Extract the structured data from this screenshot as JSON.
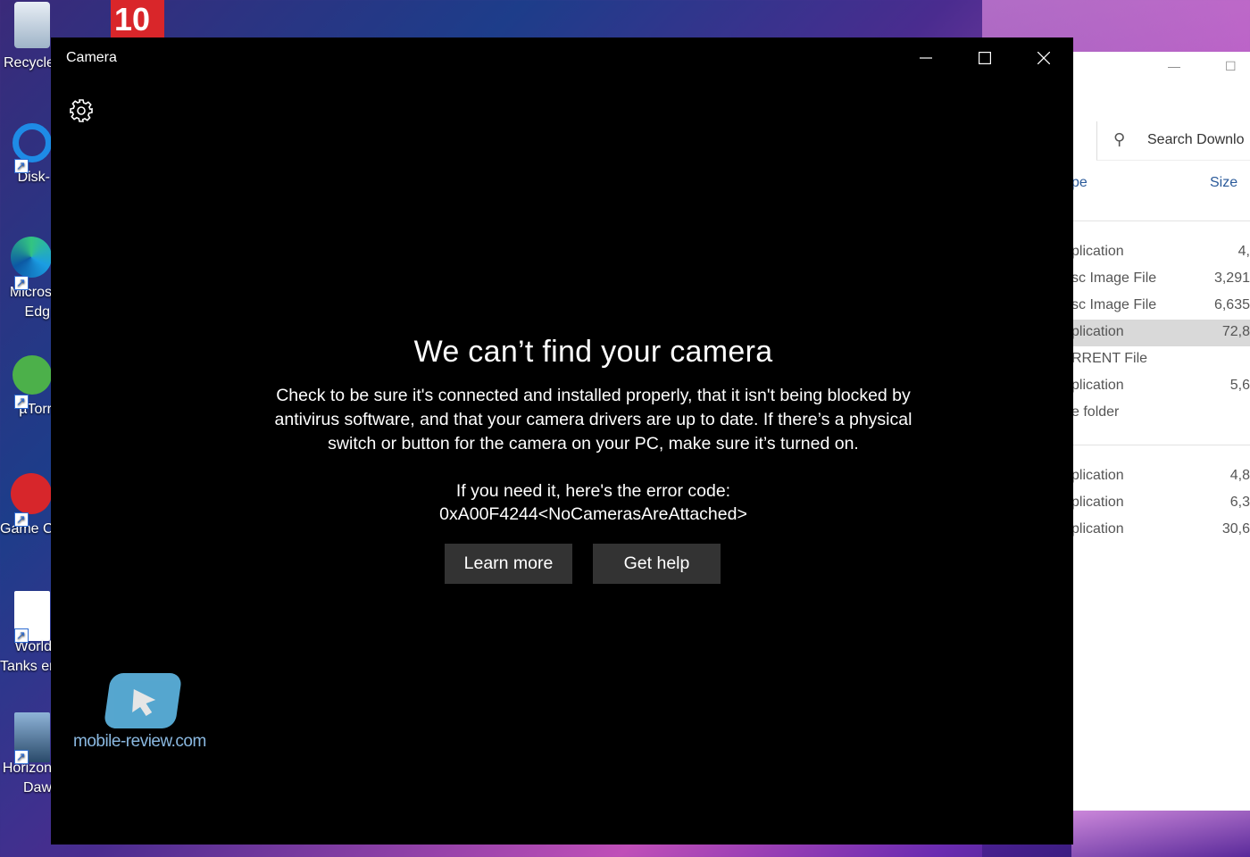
{
  "desktop": {
    "icons": [
      {
        "label": "Recycle"
      },
      {
        "label": "Disk-"
      },
      {
        "label": "Micros",
        "label2": "Edg"
      },
      {
        "label": "µTorr"
      },
      {
        "label": "Game C"
      },
      {
        "label": "World",
        "label2": "Tanks en"
      },
      {
        "label": "Horizon",
        "label2": "Daw"
      }
    ],
    "badge_text": "10"
  },
  "explorer": {
    "search_placeholder": "Search Downlo",
    "columns": [
      "pe",
      "Size"
    ],
    "rows_top": [
      {
        "type": "plication",
        "size": "4,"
      },
      {
        "type": "sc Image File",
        "size": "3,291"
      },
      {
        "type": "sc Image File",
        "size": "6,635"
      },
      {
        "type": "plication",
        "size": "72,8",
        "selected": true
      },
      {
        "type": "RRENT File",
        "size": ""
      },
      {
        "type": "plication",
        "size": "5,6"
      },
      {
        "type": "e folder",
        "size": ""
      }
    ],
    "rows_bottom": [
      {
        "type": "plication",
        "size": "4,8"
      },
      {
        "type": "plication",
        "size": "6,3"
      },
      {
        "type": "plication",
        "size": "30,6"
      }
    ]
  },
  "camera_window": {
    "title": "Camera",
    "error_title": "We can’t find your camera",
    "error_body": "Check to be sure it's connected and installed properly, that it isn't being blocked by antivirus software, and that your camera drivers are up to date. If there’s a physical switch or button for the camera on your PC, make sure it’s turned on.",
    "error_code_label": "If you need it, here's the error code:",
    "error_code": "0xA00F4244<NoCamerasAreAttached>",
    "learn_more_label": "Learn more",
    "get_help_label": "Get help"
  },
  "watermark": {
    "text": "mobile-review.com"
  }
}
